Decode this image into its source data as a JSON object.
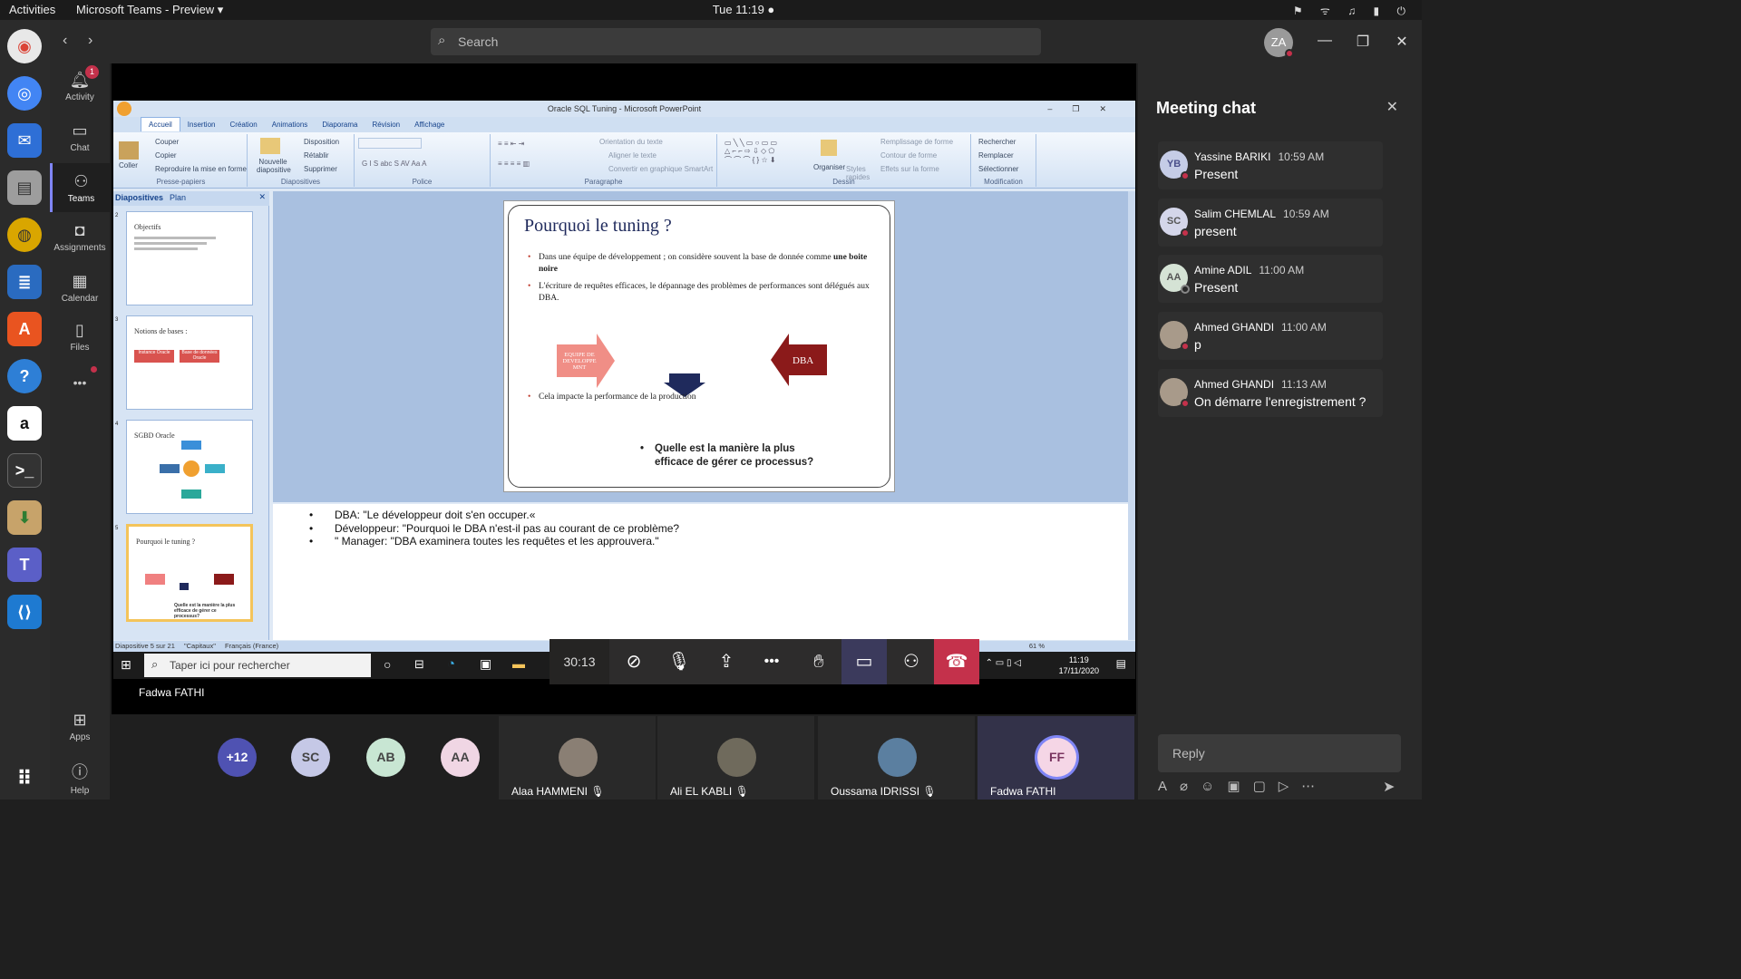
{
  "topbar": {
    "activities": "Activities",
    "app_name": "Microsoft Teams - Preview ▾",
    "clock": "Tue 11:19 ●"
  },
  "search": {
    "placeholder": "Search"
  },
  "user": {
    "initials": "ZA"
  },
  "rail": {
    "activity": "Activity",
    "activity_badge": "1",
    "chat": "Chat",
    "teams": "Teams",
    "assignments": "Assignments",
    "calendar": "Calendar",
    "files": "Files",
    "more": "•••",
    "apps": "Apps",
    "help": "Help"
  },
  "powerpoint": {
    "window_title": "Oracle SQL Tuning - Microsoft PowerPoint",
    "tabs": [
      "Accueil",
      "Insertion",
      "Création",
      "Animations",
      "Diaporama",
      "Révision",
      "Affichage"
    ],
    "clipboard": {
      "paste": "Coller",
      "cut": "Couper",
      "copy": "Copier",
      "format_painter": "Reproduire la mise en forme",
      "label": "Presse-papiers"
    },
    "slides_group": {
      "new_slide": "Nouvelle diapositive",
      "layout": "Disposition",
      "reset": "Rétablir",
      "delete": "Supprimer",
      "label": "Diapositives"
    },
    "font_label": "Police",
    "paragraph": {
      "orientation": "Orientation du texte",
      "align": "Aligner le texte",
      "smartart": "Convertir en graphique SmartArt",
      "label": "Paragraphe"
    },
    "drawing": {
      "arrange": "Organiser",
      "styles": "Styles rapides",
      "fill": "Remplissage de forme",
      "outline": "Contour de forme",
      "effects": "Effets sur la forme",
      "label": "Dessin"
    },
    "editing": {
      "find": "Rechercher",
      "replace": "Remplacer",
      "select": "Sélectionner",
      "label": "Modification"
    },
    "panel_tabs": {
      "slides": "Diapositives",
      "outline": "Plan"
    },
    "thumbnails": [
      {
        "num": "2",
        "title": "Objectifs"
      },
      {
        "num": "3",
        "title": "Notions de bases :",
        "box1": "Instance Oracle",
        "box2": "Base de données Oracle"
      },
      {
        "num": "4",
        "title": "SGBD Oracle"
      },
      {
        "num": "5",
        "title": "Pourquoi le tuning ?",
        "q": "Quelle est la manière la plus efficace de gérer ce processus?"
      }
    ],
    "slide": {
      "title": "Pourquoi le tuning ?",
      "bullet1_a": "Dans une équipe de développement   ; on considère souvent la base de donnée comme ",
      "bullet1_b": "une boite noire",
      "bullet2": " L'écriture de requêtes efficaces, le dépannage des problèmes de performances sont délégués aux DBA.",
      "arrow_left": "EQUIPE DE DEVELOPPE MNT",
      "arrow_right": "DBA",
      "bullet3": "Cela impacte la performance de la production",
      "question": "Quelle est la manière la plus efficace de gérer ce processus?"
    },
    "notes": [
      "DBA: \"Le développeur doit s'en occuper.«",
      " Développeur: \"Pourquoi le DBA n'est-il pas au courant de ce problème?",
      "\" Manager: \"DBA examinera toutes les requêtes et les approuvera.\""
    ],
    "status": {
      "slide": "Diapositive 5 sur 21",
      "theme": "\"Capitaux\"",
      "lang": "Français (France)",
      "zoom": "61 %"
    }
  },
  "windows_taskbar": {
    "search": "Taper ici pour rechercher",
    "time": "11:19",
    "date": "17/11/2020"
  },
  "meeting": {
    "timer": "30:13",
    "presenter": "Fadwa FATHI",
    "more": "•••"
  },
  "gallery": {
    "overflow": "+12",
    "avatars": [
      "SC",
      "AB",
      "AA"
    ],
    "tiles": [
      {
        "name": "Alaa HAMMENI"
      },
      {
        "name": "Ali EL KABLI"
      },
      {
        "name": "Oussama IDRISSI"
      },
      {
        "name": "Fadwa FATHI",
        "initials": "FF"
      }
    ]
  },
  "chat": {
    "title": "Meeting chat",
    "messages": [
      {
        "initials": "YB",
        "name": "Yassine BARIKI",
        "time": "10:59 AM",
        "text": "Present"
      },
      {
        "initials": "SC",
        "name": "Salim CHEMLAL",
        "time": "10:59 AM",
        "text": "present"
      },
      {
        "initials": "AA",
        "name": "Amine ADIL",
        "time": "11:00 AM",
        "text": "Present"
      },
      {
        "initials": "",
        "name": "Ahmed GHANDI",
        "time": "11:00 AM",
        "text": "p"
      },
      {
        "initials": "",
        "name": "Ahmed GHANDI",
        "time": "11:13 AM",
        "text": "On démarre l'enregistrement ?"
      }
    ],
    "reply_placeholder": "Reply"
  },
  "colors": {
    "accent": "#7f85f5",
    "hangup": "#c4314b",
    "status_busy": "#c4314b"
  }
}
